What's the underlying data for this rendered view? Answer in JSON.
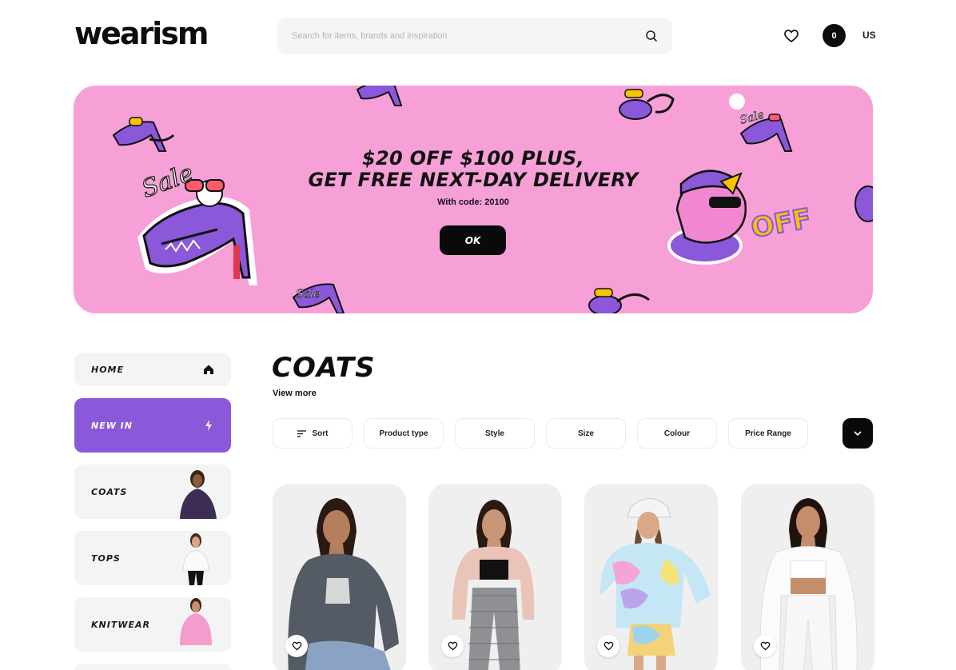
{
  "header": {
    "logo": "wearism",
    "search_placeholder": "Search for items, brands and inspiration",
    "cart_count": "0",
    "locale": "US"
  },
  "banner": {
    "title_line1": "$20 OFF $100 PLUS,",
    "title_line2": "GET FREE NEXT-DAY DELIVERY",
    "code_text": "With code: 20100",
    "button_label": "OK",
    "background": "#f7a0d8"
  },
  "sidebar": {
    "items": [
      {
        "label": "HOME",
        "icon": "home-icon"
      },
      {
        "label": "NEW IN",
        "icon": "lightning-icon",
        "active": true
      },
      {
        "label": "COATS"
      },
      {
        "label": "TOPS"
      },
      {
        "label": "KNITWEAR"
      }
    ]
  },
  "main": {
    "title": "COATS",
    "view_more": "View more",
    "filters": [
      "Sort",
      "Product type",
      "Style",
      "Size",
      "Colour",
      "Price Range"
    ],
    "filter_toggle_icon": "chevron-down-icon"
  },
  "products": [
    {
      "fav_icon": "heart-icon"
    },
    {
      "fav_icon": "heart-icon"
    },
    {
      "fav_icon": "heart-icon"
    },
    {
      "fav_icon": "heart-icon"
    }
  ],
  "colors": {
    "accent": "#8a58d9",
    "banner": "#f7a0d8",
    "dark": "#0a0a0a"
  }
}
